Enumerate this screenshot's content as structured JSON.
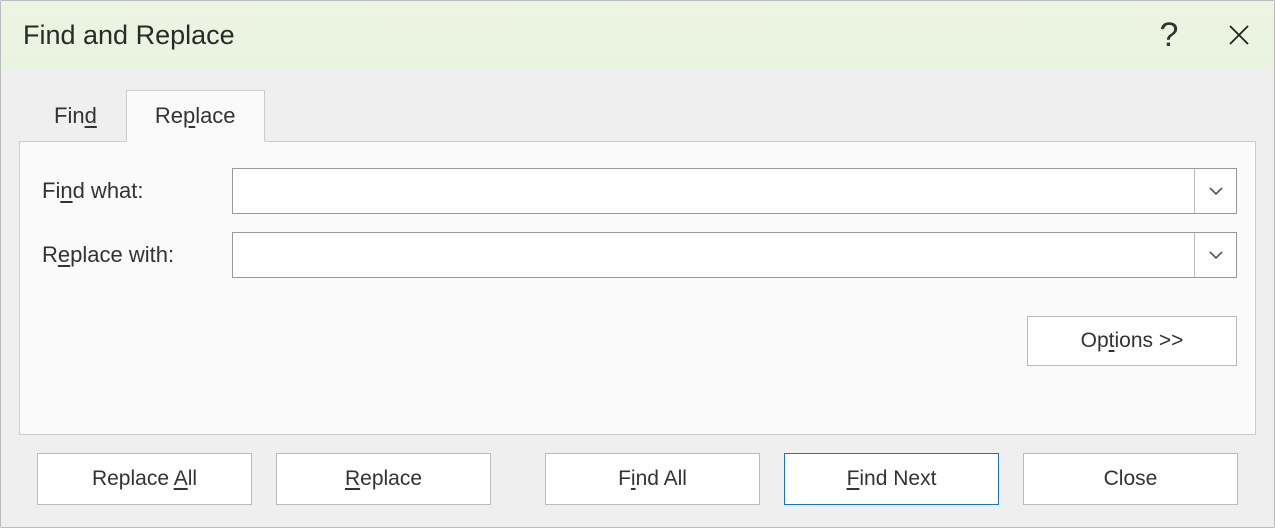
{
  "title": "Find and Replace",
  "tabs": {
    "find": {
      "pre": "Fin",
      "accel": "d",
      "post": ""
    },
    "replace": {
      "pre": "Re",
      "accel": "p",
      "post": "lace"
    }
  },
  "fields": {
    "find_what": {
      "label_pre": "Fi",
      "label_accel": "n",
      "label_post": "d what:",
      "value": ""
    },
    "replace_with": {
      "label_pre": "R",
      "label_accel": "e",
      "label_post": "place with:",
      "value": ""
    }
  },
  "options_btn": {
    "pre": "Op",
    "accel": "t",
    "post": "ions >>"
  },
  "buttons": {
    "replace_all": {
      "pre": "Replace ",
      "accel": "A",
      "post": "ll"
    },
    "replace": {
      "pre": "",
      "accel": "R",
      "post": "eplace"
    },
    "find_all": {
      "pre": "F",
      "accel": "i",
      "post": "nd All"
    },
    "find_next": {
      "pre": "",
      "accel": "F",
      "post": "ind Next"
    },
    "close": {
      "pre": "Close",
      "accel": "",
      "post": ""
    }
  }
}
